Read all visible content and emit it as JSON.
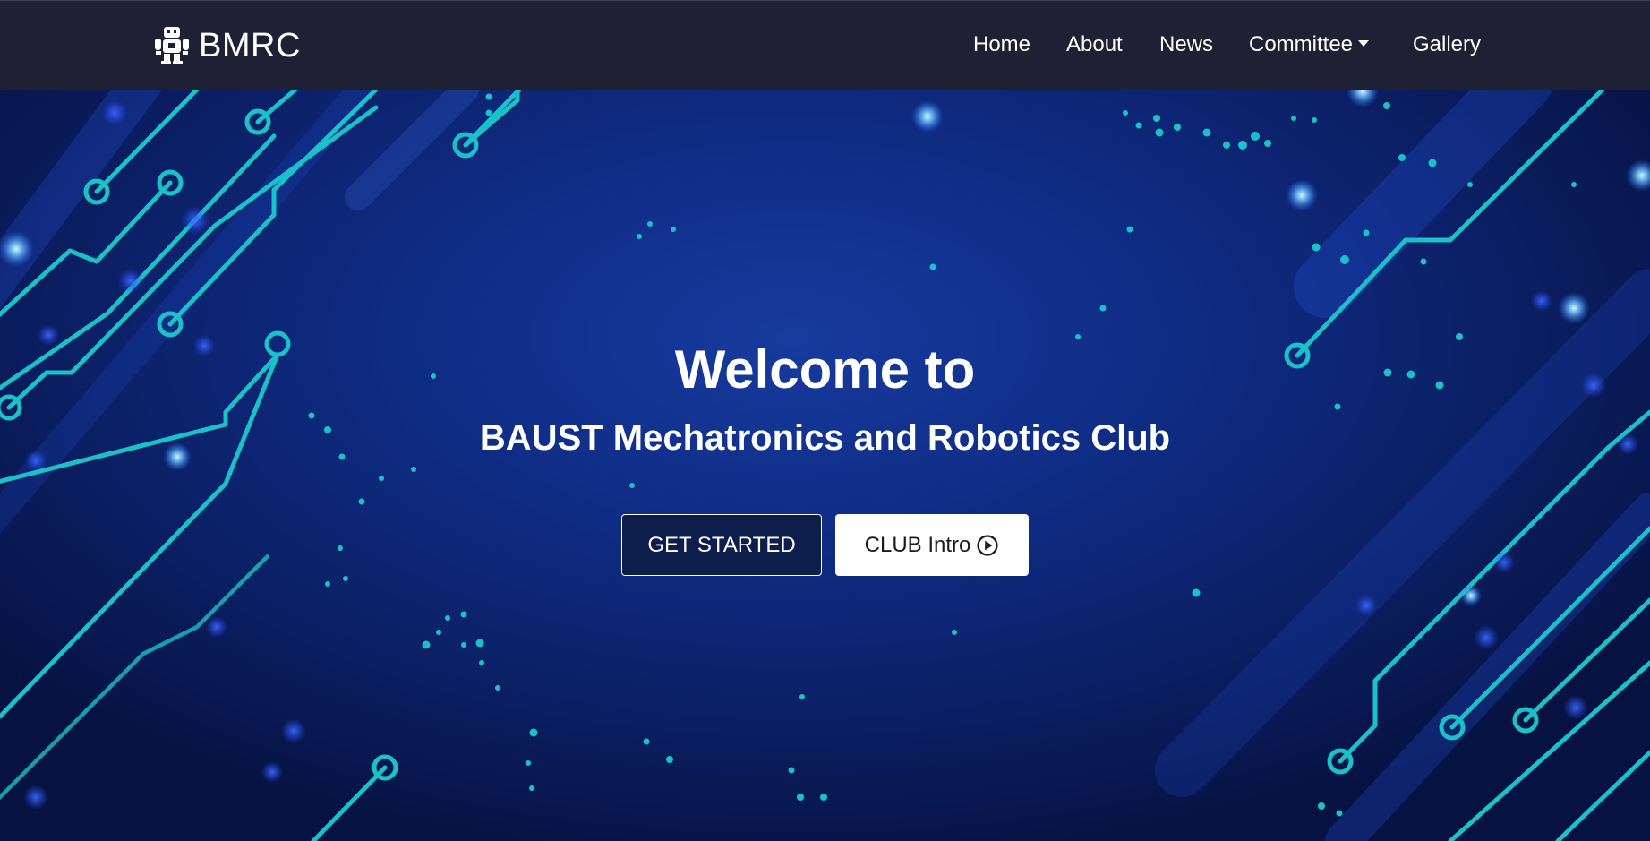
{
  "navbar": {
    "brand": {
      "logo_icon": "robot-icon",
      "text": "BMRC"
    },
    "items": [
      {
        "label": "Home"
      },
      {
        "label": "About"
      },
      {
        "label": "News"
      },
      {
        "label": "Committee",
        "icon": "caret-down-icon"
      },
      {
        "label": "Gallery"
      }
    ]
  },
  "hero": {
    "title": "Welcome to",
    "subtitle": "BAUST Mechatronics and Robotics Club",
    "primary_button": "GET STARTED",
    "secondary_button": {
      "label": "CLUB Intro",
      "icon": "play-circle-icon"
    }
  },
  "colors": {
    "navbar_bg": "#1d2133",
    "hero_bg": "#0f2c84",
    "circuit": "#1cc7c7",
    "text": "#ffffff"
  }
}
